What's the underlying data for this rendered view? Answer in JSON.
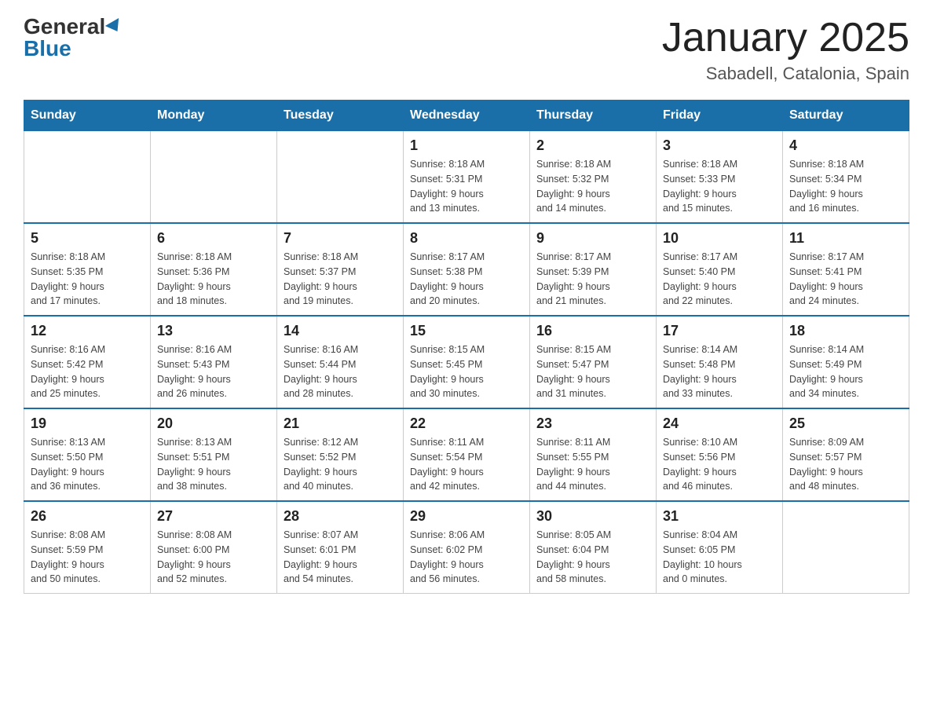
{
  "header": {
    "logo_general": "General",
    "logo_blue": "Blue",
    "month_title": "January 2025",
    "subtitle": "Sabadell, Catalonia, Spain"
  },
  "days_of_week": [
    "Sunday",
    "Monday",
    "Tuesday",
    "Wednesday",
    "Thursday",
    "Friday",
    "Saturday"
  ],
  "weeks": [
    [
      {
        "day": "",
        "info": ""
      },
      {
        "day": "",
        "info": ""
      },
      {
        "day": "",
        "info": ""
      },
      {
        "day": "1",
        "info": "Sunrise: 8:18 AM\nSunset: 5:31 PM\nDaylight: 9 hours\nand 13 minutes."
      },
      {
        "day": "2",
        "info": "Sunrise: 8:18 AM\nSunset: 5:32 PM\nDaylight: 9 hours\nand 14 minutes."
      },
      {
        "day": "3",
        "info": "Sunrise: 8:18 AM\nSunset: 5:33 PM\nDaylight: 9 hours\nand 15 minutes."
      },
      {
        "day": "4",
        "info": "Sunrise: 8:18 AM\nSunset: 5:34 PM\nDaylight: 9 hours\nand 16 minutes."
      }
    ],
    [
      {
        "day": "5",
        "info": "Sunrise: 8:18 AM\nSunset: 5:35 PM\nDaylight: 9 hours\nand 17 minutes."
      },
      {
        "day": "6",
        "info": "Sunrise: 8:18 AM\nSunset: 5:36 PM\nDaylight: 9 hours\nand 18 minutes."
      },
      {
        "day": "7",
        "info": "Sunrise: 8:18 AM\nSunset: 5:37 PM\nDaylight: 9 hours\nand 19 minutes."
      },
      {
        "day": "8",
        "info": "Sunrise: 8:17 AM\nSunset: 5:38 PM\nDaylight: 9 hours\nand 20 minutes."
      },
      {
        "day": "9",
        "info": "Sunrise: 8:17 AM\nSunset: 5:39 PM\nDaylight: 9 hours\nand 21 minutes."
      },
      {
        "day": "10",
        "info": "Sunrise: 8:17 AM\nSunset: 5:40 PM\nDaylight: 9 hours\nand 22 minutes."
      },
      {
        "day": "11",
        "info": "Sunrise: 8:17 AM\nSunset: 5:41 PM\nDaylight: 9 hours\nand 24 minutes."
      }
    ],
    [
      {
        "day": "12",
        "info": "Sunrise: 8:16 AM\nSunset: 5:42 PM\nDaylight: 9 hours\nand 25 minutes."
      },
      {
        "day": "13",
        "info": "Sunrise: 8:16 AM\nSunset: 5:43 PM\nDaylight: 9 hours\nand 26 minutes."
      },
      {
        "day": "14",
        "info": "Sunrise: 8:16 AM\nSunset: 5:44 PM\nDaylight: 9 hours\nand 28 minutes."
      },
      {
        "day": "15",
        "info": "Sunrise: 8:15 AM\nSunset: 5:45 PM\nDaylight: 9 hours\nand 30 minutes."
      },
      {
        "day": "16",
        "info": "Sunrise: 8:15 AM\nSunset: 5:47 PM\nDaylight: 9 hours\nand 31 minutes."
      },
      {
        "day": "17",
        "info": "Sunrise: 8:14 AM\nSunset: 5:48 PM\nDaylight: 9 hours\nand 33 minutes."
      },
      {
        "day": "18",
        "info": "Sunrise: 8:14 AM\nSunset: 5:49 PM\nDaylight: 9 hours\nand 34 minutes."
      }
    ],
    [
      {
        "day": "19",
        "info": "Sunrise: 8:13 AM\nSunset: 5:50 PM\nDaylight: 9 hours\nand 36 minutes."
      },
      {
        "day": "20",
        "info": "Sunrise: 8:13 AM\nSunset: 5:51 PM\nDaylight: 9 hours\nand 38 minutes."
      },
      {
        "day": "21",
        "info": "Sunrise: 8:12 AM\nSunset: 5:52 PM\nDaylight: 9 hours\nand 40 minutes."
      },
      {
        "day": "22",
        "info": "Sunrise: 8:11 AM\nSunset: 5:54 PM\nDaylight: 9 hours\nand 42 minutes."
      },
      {
        "day": "23",
        "info": "Sunrise: 8:11 AM\nSunset: 5:55 PM\nDaylight: 9 hours\nand 44 minutes."
      },
      {
        "day": "24",
        "info": "Sunrise: 8:10 AM\nSunset: 5:56 PM\nDaylight: 9 hours\nand 46 minutes."
      },
      {
        "day": "25",
        "info": "Sunrise: 8:09 AM\nSunset: 5:57 PM\nDaylight: 9 hours\nand 48 minutes."
      }
    ],
    [
      {
        "day": "26",
        "info": "Sunrise: 8:08 AM\nSunset: 5:59 PM\nDaylight: 9 hours\nand 50 minutes."
      },
      {
        "day": "27",
        "info": "Sunrise: 8:08 AM\nSunset: 6:00 PM\nDaylight: 9 hours\nand 52 minutes."
      },
      {
        "day": "28",
        "info": "Sunrise: 8:07 AM\nSunset: 6:01 PM\nDaylight: 9 hours\nand 54 minutes."
      },
      {
        "day": "29",
        "info": "Sunrise: 8:06 AM\nSunset: 6:02 PM\nDaylight: 9 hours\nand 56 minutes."
      },
      {
        "day": "30",
        "info": "Sunrise: 8:05 AM\nSunset: 6:04 PM\nDaylight: 9 hours\nand 58 minutes."
      },
      {
        "day": "31",
        "info": "Sunrise: 8:04 AM\nSunset: 6:05 PM\nDaylight: 10 hours\nand 0 minutes."
      },
      {
        "day": "",
        "info": ""
      }
    ]
  ]
}
